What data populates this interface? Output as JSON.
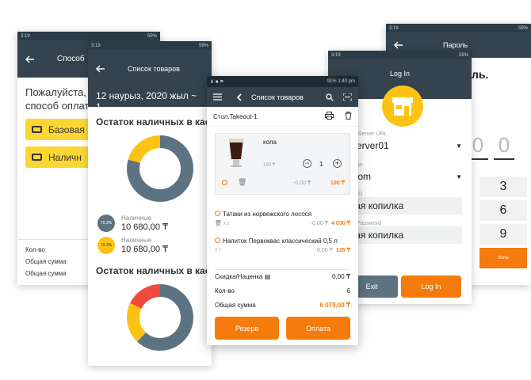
{
  "phone_a": {
    "time": "3:19",
    "battery": "59%",
    "title": "Способ",
    "prompt_line1": "Пожалуйста, в",
    "prompt_line2": "способ оплаты",
    "pay_base": "Базовая к",
    "pay_cash": "Наличн",
    "qty_label": "Кол-во",
    "total_label1": "Общая сумма",
    "total_label2": "Общая сумма"
  },
  "phone_b": {
    "time": "3:19",
    "battery": "59%",
    "title": "Список товаров",
    "date": "12 наурыз, 2020 жыл ~ 1",
    "cash_title_1": "Остаток наличных в кас",
    "cash_title_2": "Остаток наличных в кас",
    "legend": [
      {
        "pct": "79.3%",
        "label": "Наличные",
        "value": "10 680,00 ₸",
        "color": "#5e7381"
      },
      {
        "pct": "79.3%",
        "label": "Наличные",
        "value": "10 680,00 ₸",
        "color": "#fcc312"
      }
    ],
    "donut1": [
      {
        "share": 0.793,
        "color": "#5e7381"
      },
      {
        "share": 0.207,
        "color": "#fcc312"
      }
    ],
    "donut2": [
      {
        "share": 0.62,
        "color": "#5e7381"
      },
      {
        "share": 0.2,
        "color": "#fcc312"
      },
      {
        "share": 0.18,
        "color": "#f14a3c"
      }
    ]
  },
  "phone_c": {
    "time": "1:40 pm",
    "battery": "91%",
    "title": "Список товаров",
    "table_name": "Стол.Takeout-1",
    "card": {
      "name": "кола",
      "unit_price": "100 ₸",
      "qty": "1",
      "discount": "-0,00 ₸",
      "total": "100 ₸"
    },
    "items": [
      {
        "name": "Татаки из норвежского лосося",
        "qty": "X 1",
        "discount": "-0,00 ₸",
        "total": "4 030 ₸"
      },
      {
        "name": "Напиток Первоквас классический 0,5 л",
        "qty": "X 1",
        "discount": "-0,00 ₸",
        "total": "135 ₸"
      }
    ],
    "discount_label": "Скидка/Наценка",
    "discount_value": "0,00 ₸",
    "qty_label": "Кол-во",
    "qty_value": "6",
    "total_label": "Общая сумма",
    "total_value": "6 079,00 ₸",
    "reserve_button": "Резерв",
    "pay_button": "Оплата"
  },
  "phone_d": {
    "time": "3:19",
    "battery": "59%",
    "title": "Log In",
    "server_label": "ud Server URL",
    "server_value": "Server01",
    "domain_label": "main",
    "domain_value": ".com",
    "store_label": "re ID",
    "store_value": "вая копилка",
    "password_label": "re Password",
    "password_value": "вая копилка",
    "exit_button": "Exit",
    "login_button": "Log In"
  },
  "phone_e": {
    "time": "3:19",
    "battery": "59%",
    "title": "Пароль",
    "heading": "ль.",
    "digits": [
      "0",
      "0"
    ],
    "keys": [
      "3",
      "6",
      "9"
    ],
    "done": "done"
  },
  "colors": {
    "accent": "#f47b0c",
    "appbar": "#34434d",
    "yellow": "#fcd733",
    "slate": "#5e7381"
  }
}
